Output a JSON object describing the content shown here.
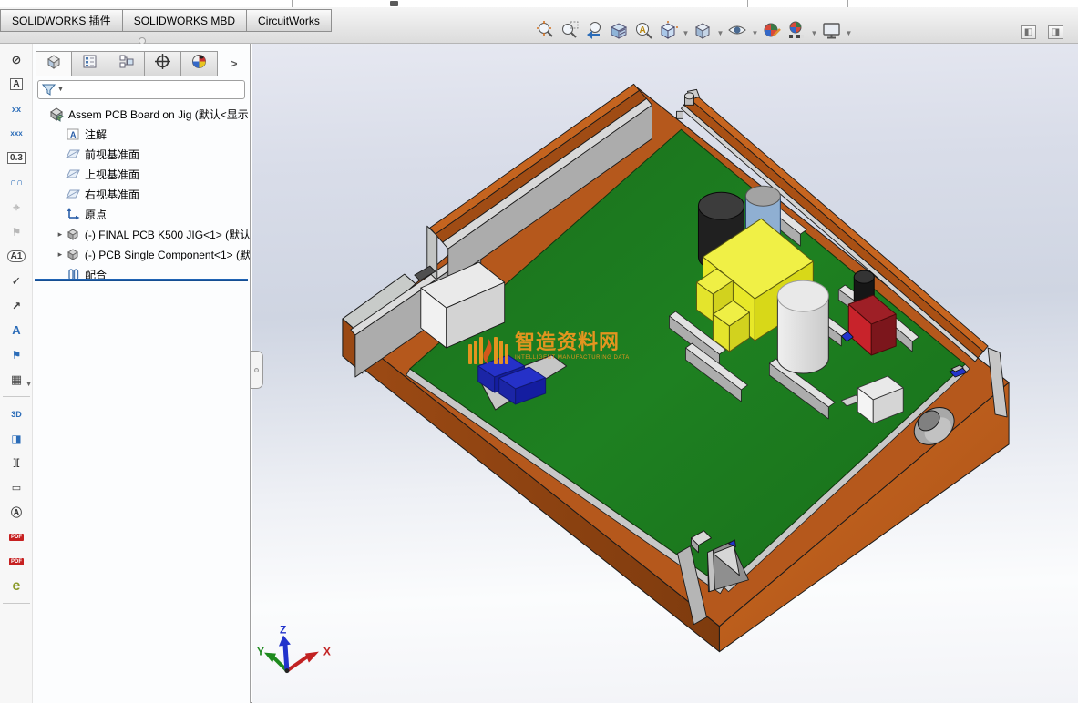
{
  "ribbon_tabs": [
    {
      "label": "SOLIDWORKS 插件"
    },
    {
      "label": "SOLIDWORKS MBD"
    },
    {
      "label": "CircuitWorks"
    }
  ],
  "headsup_toolbar": {
    "caret_glyph": "▼",
    "icons": [
      {
        "name": "zoom-to-fit-icon"
      },
      {
        "name": "zoom-to-area-icon"
      },
      {
        "name": "previous-view-icon"
      },
      {
        "name": "section-view-icon"
      },
      {
        "name": "dynamic-annotation-views-icon"
      },
      {
        "name": "view-orientation-icon",
        "caret": true
      },
      {
        "name": "display-style-icon",
        "caret": true
      },
      {
        "name": "hide-show-items-icon",
        "caret": true
      },
      {
        "name": "edit-appearance-icon"
      },
      {
        "name": "apply-scene-icon",
        "caret": true
      },
      {
        "name": "view-settings-icon",
        "caret": true
      }
    ]
  },
  "window_buttons": {
    "collapse_left_glyph": "◧",
    "collapse_right_glyph": "◨"
  },
  "feature_panel": {
    "tabs": [
      {
        "name": "featuremanager-design-tree",
        "active": true
      },
      {
        "name": "propertymanager",
        "active": false
      },
      {
        "name": "configurationmanager",
        "active": false
      },
      {
        "name": "dimxpertmanager",
        "active": false
      },
      {
        "name": "displaymanager",
        "active": false
      }
    ],
    "tabs_overflow_glyph": ">",
    "filter": {
      "value": "",
      "placeholder": ""
    },
    "expander_glyph": "▸",
    "tree": [
      {
        "icon": "assembly",
        "level": 0,
        "expandable": false,
        "label": "Assem PCB Board on Jig  (默认<显示"
      },
      {
        "icon": "annotations",
        "level": 1,
        "expandable": false,
        "label": "注解"
      },
      {
        "icon": "plane",
        "level": 1,
        "expandable": false,
        "label": "前视基准面"
      },
      {
        "icon": "plane",
        "level": 1,
        "expandable": false,
        "label": "上视基准面"
      },
      {
        "icon": "plane",
        "level": 1,
        "expandable": false,
        "label": "右视基准面"
      },
      {
        "icon": "origin",
        "level": 1,
        "expandable": false,
        "label": "原点"
      },
      {
        "icon": "component",
        "level": 1,
        "expandable": true,
        "label": "(-) FINAL PCB K500 JIG<1> (默认"
      },
      {
        "icon": "component",
        "level": 1,
        "expandable": true,
        "label": "(-) PCB Single Component<1> (默"
      },
      {
        "icon": "mates",
        "level": 1,
        "expandable": false,
        "label": "配合"
      }
    ]
  },
  "left_toolbar": {
    "icons": [
      {
        "name": "auto-dimension-scheme-icon",
        "glyph": "⊘",
        "color": "#3a3a3a",
        "size": 13
      },
      {
        "name": "location-note-icon",
        "glyph": "A",
        "color": "#3a3a3a",
        "boxed": true
      },
      {
        "name": "size-dimension-icon",
        "glyph": "xx",
        "color": "#2b6cb8",
        "size": 9
      },
      {
        "name": "basic-size-dimension-icon",
        "glyph": "xxx",
        "color": "#2b6cb8",
        "size": 8
      },
      {
        "name": "tolerance-status-icon",
        "glyph": "0.3",
        "color": "#3a3a3a",
        "boxed": true
      },
      {
        "name": "geometric-tolerance-icon",
        "glyph": "∩∩",
        "color": "#2b6cb8",
        "size": 10
      },
      {
        "name": "datum-target-icon",
        "glyph": "⌖",
        "color": "#b8b8b8",
        "size": 13,
        "disabled": true
      },
      {
        "name": "show-tolerance-status-icon",
        "glyph": "⚑",
        "color": "#b8b8b8",
        "size": 12,
        "disabled": true
      },
      {
        "name": "datum-feature-icon",
        "glyph": "A1",
        "color": "#3a3a3a",
        "oval": true
      },
      {
        "name": "surface-finish-icon",
        "glyph": "✓",
        "color": "#3a3a3a",
        "size": 13
      },
      {
        "name": "weld-symbol-icon",
        "glyph": "↗",
        "color": "#3a3a3a",
        "size": 12
      },
      {
        "name": "note-icon",
        "glyph": "A",
        "color": "#2b6cb8",
        "size": 13
      },
      {
        "name": "balloon-icon",
        "glyph": "⚑",
        "color": "#2b6cb8",
        "size": 12
      },
      {
        "name": "general-table-icon",
        "glyph": "▦",
        "color": "#4a4a4a",
        "size": 13,
        "caret": true,
        "sep_after": true
      },
      {
        "name": "capture-3d-view-icon",
        "glyph": "3D",
        "color": "#2b6cb8",
        "size": 9
      },
      {
        "name": "section-view-tool-icon",
        "glyph": "◨",
        "color": "#2b6cb8",
        "size": 12
      },
      {
        "name": "break-view-icon",
        "glyph": "][",
        "color": "#3a3a3a",
        "size": 10
      },
      {
        "name": "mouse-gestures-icon",
        "glyph": "▭",
        "color": "#3a3a3a",
        "size": 11
      },
      {
        "name": "magnified-view-icon",
        "glyph": "Ⓐ",
        "color": "#3a3a3a",
        "size": 12
      },
      {
        "name": "edit-3d-pdf-icon",
        "glyph": "PDF",
        "badge": true
      },
      {
        "name": "publish-3d-pdf-icon",
        "glyph": "PDF",
        "badge": true
      },
      {
        "name": "edrawings-icon",
        "glyph": "e",
        "color": "#8a9a28",
        "size": 16,
        "sep_after": true
      }
    ]
  },
  "viewport": {
    "watermark": {
      "title": "智造资料网",
      "subtitle": "INTELLIGENT MANUFACTURING DATA",
      "color": "#f2971f"
    },
    "triad": {
      "x": "X",
      "y": "Y",
      "z": "Z"
    },
    "model_colors": {
      "jig_orange_top": "#b5581c",
      "jig_orange_bright": "#c4631e",
      "jig_orange_dark": "#9a4a14",
      "pcb_green": "#1c7a1e",
      "wall_gray": "#acacac",
      "transformer_yellow": "#eded3a",
      "capacitor_black": "#202020",
      "capacitor_blue": "#8fafd2",
      "capacitor_white": "#dddddd",
      "component_red": "#c8232b",
      "connector_blue": "#2531c8",
      "rollback_blue": "#1f63b4"
    }
  }
}
